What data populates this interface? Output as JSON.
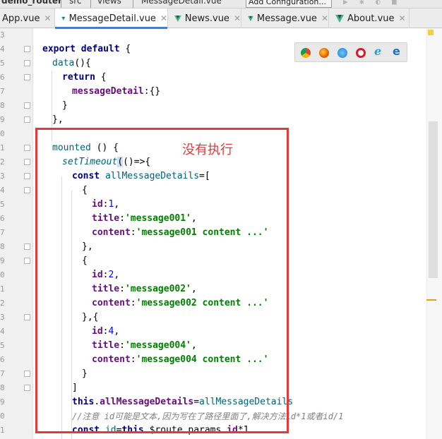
{
  "breadcrumb": {
    "project": "demo_router",
    "src": "src",
    "views": "views",
    "file": "MessageDetail.vue",
    "config_button": "Add Configuration..."
  },
  "tabs": [
    {
      "label": "App.vue"
    },
    {
      "label": "MessageDetail.vue",
      "active": true
    },
    {
      "label": "News.vue"
    },
    {
      "label": "Message.vue"
    },
    {
      "label": "About.vue"
    }
  ],
  "line_numbers": [
    "3",
    "4",
    "5",
    "6",
    "7",
    "8",
    "9",
    "0",
    "1",
    "2",
    "3",
    "4",
    "5",
    "6",
    "7",
    "8",
    "9",
    "0",
    "1",
    "2",
    "3",
    "4",
    "5",
    "6",
    "7",
    "8",
    "9",
    "0",
    "1"
  ],
  "code": {
    "l1_a": "export",
    "l1_b": "default",
    "l1_c": " {",
    "l2_a": "data",
    "l2_b": "(){",
    "l3_a": "return",
    "l3_b": " {",
    "l4_a": "messageDetail",
    "l4_b": ":{}",
    "l5": "}",
    "l6": "},",
    "l7_a": "mounted",
    "l7_b": " () {",
    "l8_a": "setTimeout",
    "l8_b": "(",
    "l8_c": "()=>{",
    "l9_a": "const",
    "l9_b": " allMessageDetails",
    "l9_c": "=[",
    "l10": "{",
    "l11_a": "id",
    "l11_b": ":",
    "l11_c": "1",
    "l11_d": ",",
    "l12_a": "title",
    "l12_b": ":",
    "l12_c": "'message001'",
    "l12_d": ",",
    "l13_a": "content",
    "l13_b": ":",
    "l13_c": "'message001 content ...'",
    "l14": "},",
    "l15": "{",
    "l16_a": "id",
    "l16_b": ":",
    "l16_c": "2",
    "l16_d": ",",
    "l17_a": "title",
    "l17_b": ":",
    "l17_c": "'message002'",
    "l17_d": ",",
    "l18_a": "content",
    "l18_b": ":",
    "l18_c": "'message002 content ...'",
    "l19": "},{",
    "l20_a": "id",
    "l20_b": ":",
    "l20_c": "4",
    "l20_d": ",",
    "l21_a": "title",
    "l21_b": ":",
    "l21_c": "'message004'",
    "l21_d": ",",
    "l22_a": "content",
    "l22_b": ":",
    "l22_c": "'message004 content ...'",
    "l23": "}",
    "l24": "]",
    "l25_a": "this",
    "l25_b": ".",
    "l25_c": "allMessageDetails",
    "l25_d": "=",
    "l25_e": "allMessageDetails",
    "l26": "//注意 id可能是文本,因为写在了路径里面了,解决方法id*1或者id/1",
    "l27_a": "const",
    "l27_b": " id",
    "l27_c": "=",
    "l27_d": "this",
    "l27_e": ".$route.params.",
    "l27_f": "id",
    "l27_g": "*1"
  },
  "annotation": "没有执行",
  "browser_icons": [
    "chrome-icon",
    "firefox-icon",
    "safari-icon",
    "opera-icon",
    "ie-icon",
    "edge-icon"
  ],
  "colors": {
    "annotation_red": "#e03a3a",
    "keyword": "#000080",
    "property": "#660e7a",
    "string": "#008000",
    "number": "#0000ff",
    "active_tab_underline": "#4a7dbf"
  }
}
